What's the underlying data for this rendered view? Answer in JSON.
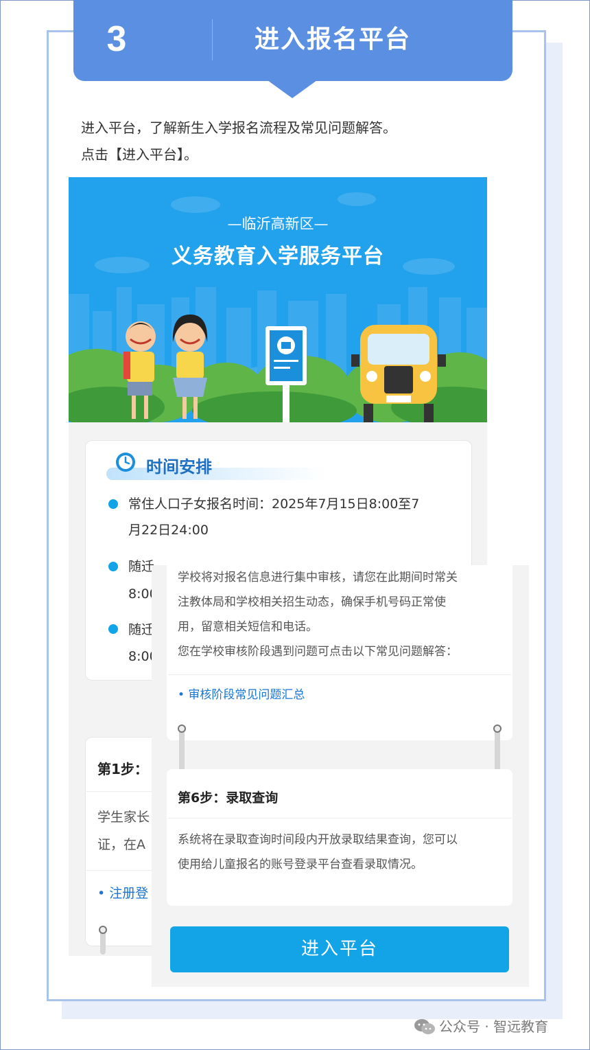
{
  "header": {
    "step_number": "3",
    "title": "进入报名平台"
  },
  "intro": {
    "line1": "进入平台，了解新生入学报名流程及常见问题解答。",
    "line2": "点击【进入平台】。"
  },
  "hero": {
    "subtitle": "—临沂高新区—",
    "title": "义务教育入学服务平台"
  },
  "schedule": {
    "title": "时间安排",
    "items": [
      {
        "line1": "常住人口子女报名时间：2025年7月15日8:00至7",
        "line2": "月22日24:00"
      },
      {
        "line1": "随迁",
        "line2": "8:00"
      },
      {
        "line1": "随迁",
        "line2": "8:00"
      }
    ]
  },
  "step1": {
    "title": "第1步：",
    "text_line1": "学生家长",
    "text_line2": "证，在A",
    "link": "• 注册登"
  },
  "review": {
    "text_lines": [
      "学校将对报名信息进行集中审核，请您在此期间时常关",
      "注教体局和学校相关招生动态，确保手机号码正常使",
      "用，留意相关短信和电话。",
      "您在学校审核阶段遇到问题可点击以下常见问题解答："
    ],
    "link": "• 审核阶段常见问题汇总"
  },
  "step6": {
    "title": "第6步：录取查询",
    "text_lines": [
      "系统将在录取查询时间段内开放录取结果查询，您可以",
      "使用给儿童报名的账号登录平台查看录取情况。"
    ]
  },
  "enter_button": {
    "label": "进入平台"
  },
  "watermark": {
    "text": "公众号 · 智远教育"
  },
  "colors": {
    "header_blue": "#5b8fe1",
    "accent_blue": "#13a4e8",
    "link_blue": "#1976d2",
    "hero_sky": "#22a1ec"
  },
  "icons": [
    "clock-icon",
    "wechat-icon",
    "school-sign-icon"
  ]
}
